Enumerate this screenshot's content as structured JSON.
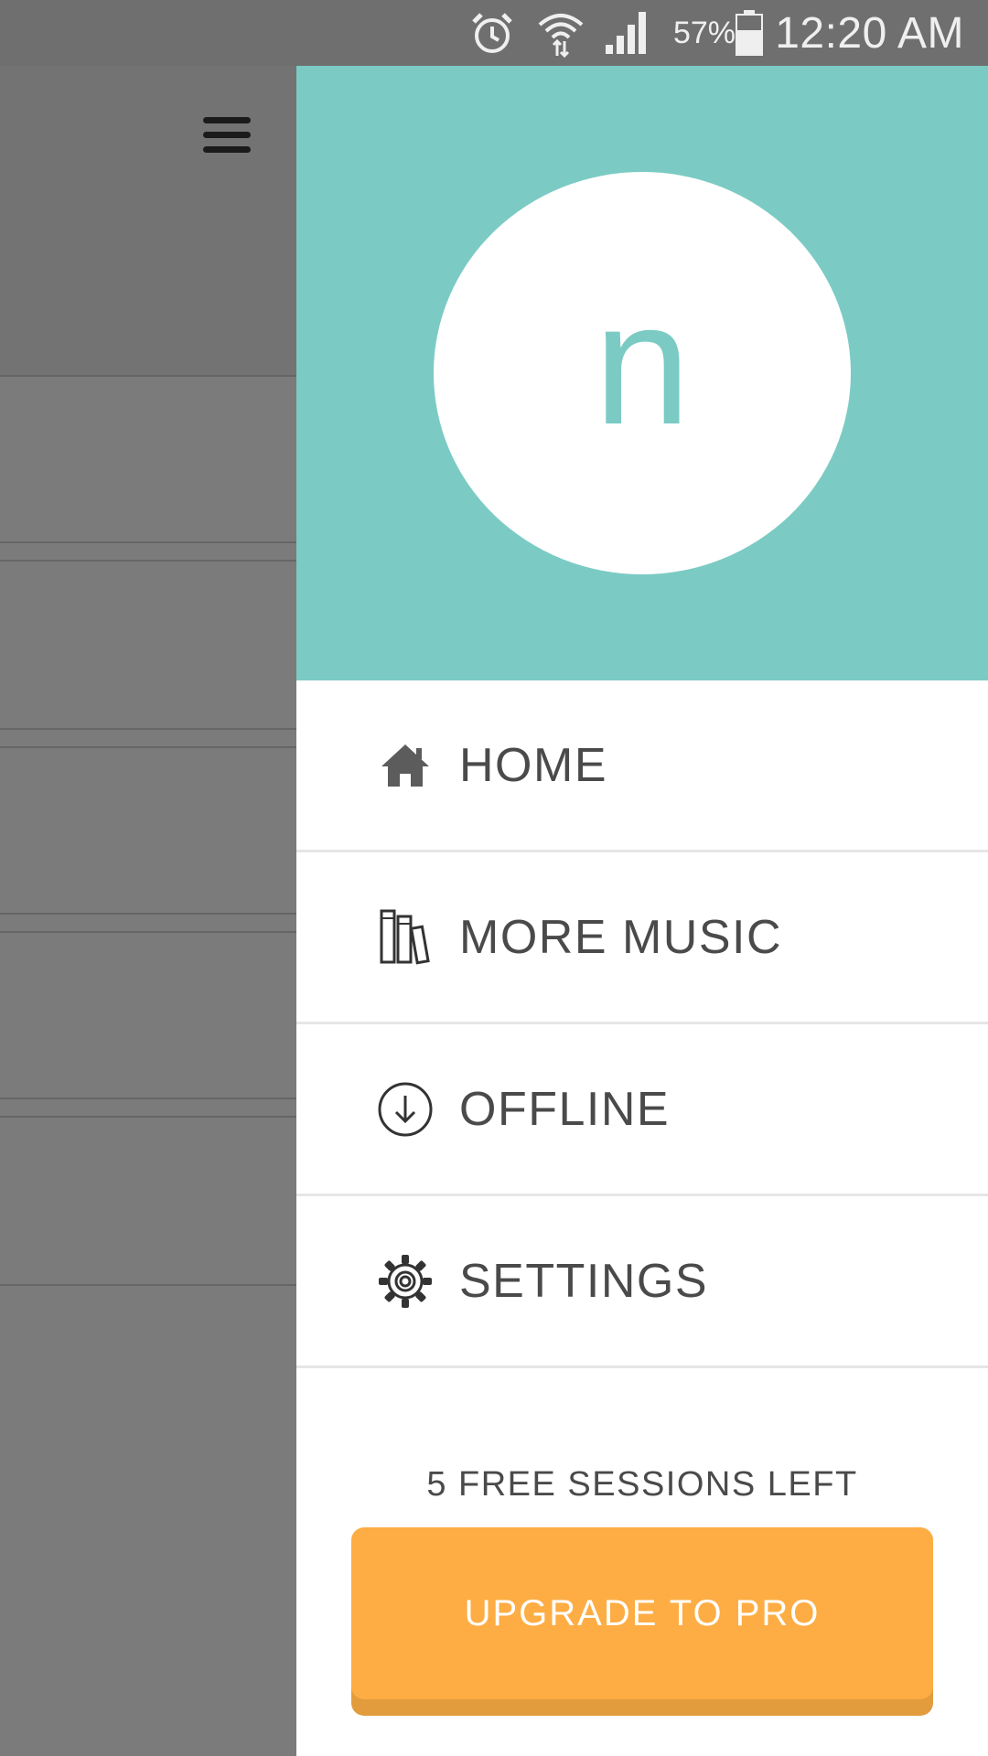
{
  "status_bar": {
    "battery_percent": "57%",
    "time": "12:20 AM"
  },
  "drawer": {
    "avatar_letter": "n",
    "nav_items": [
      {
        "label": "HOME",
        "icon": "home-icon"
      },
      {
        "label": "MORE MUSIC",
        "icon": "books-icon"
      },
      {
        "label": "OFFLINE",
        "icon": "download-icon"
      },
      {
        "label": "SETTINGS",
        "icon": "gear-icon"
      }
    ],
    "sessions_text": "5 FREE SESSIONS LEFT",
    "upgrade_label": "UPGRADE TO PRO"
  },
  "colors": {
    "header_teal": "#7bcbc4",
    "upgrade_orange": "#fdad43",
    "text_dark": "#4a4a4a"
  }
}
